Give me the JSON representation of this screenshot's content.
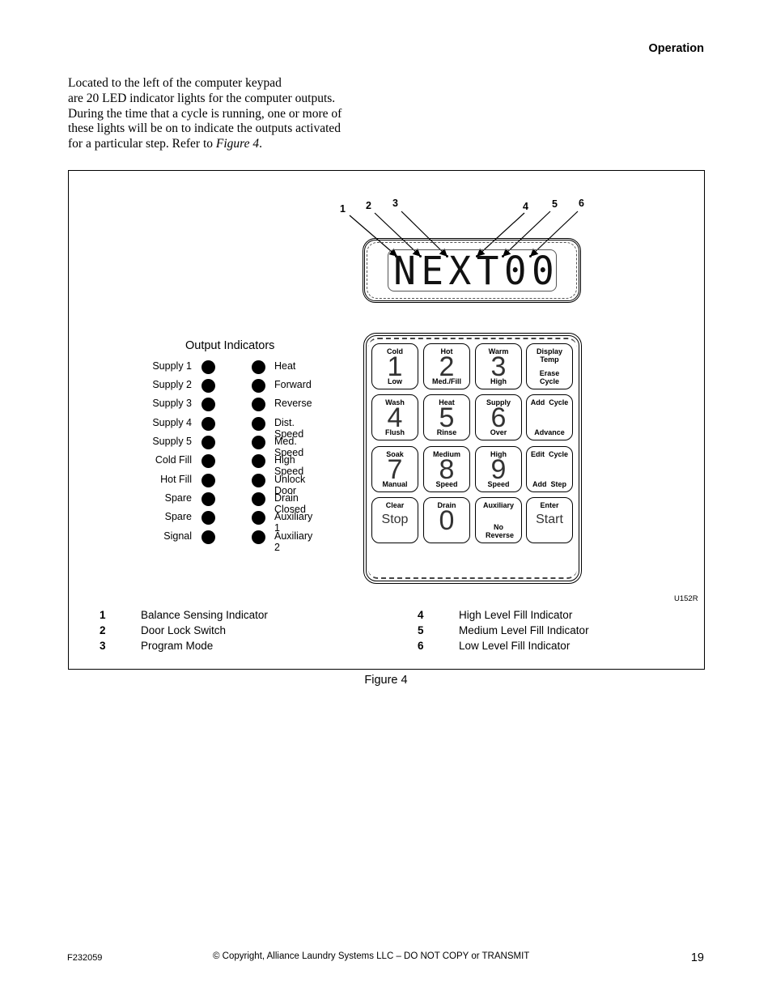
{
  "header": {
    "section": "Operation"
  },
  "intro": {
    "lines": [
      "Located to the left of the computer keypad",
      "are 20 LED indicator lights for the computer outputs.",
      "During the time that a cycle is running, one or more of",
      "these lights will be on to indicate the outputs activated"
    ],
    "last_line_prefix": "for a particular step. Refer to ",
    "last_line_ref": "Figure 4",
    "last_line_suffix": "."
  },
  "figure": {
    "display": {
      "text": [
        "N",
        "E",
        "X",
        "T",
        "0",
        "0"
      ],
      "callouts": [
        "1",
        "2",
        "3",
        "4",
        "5",
        "6"
      ]
    },
    "output_indicators": {
      "title": "Output Indicators",
      "left": [
        "Supply 1",
        "Supply 2",
        "Supply 3",
        "Supply 4",
        "Supply 5",
        "Cold Fill",
        "Hot Fill",
        "Spare",
        "Spare",
        "Signal"
      ],
      "right": [
        "Heat",
        "Forward",
        "Reverse",
        "Dist. Speed",
        "Med. Speed",
        "High Speed",
        "Unlock Door",
        "Drain Closed",
        "Auxiliary 1",
        "Auxiliary 2"
      ]
    },
    "keypad": {
      "keys": [
        {
          "top": "Cold",
          "main": "1",
          "bottom": "Low"
        },
        {
          "top": "Hot",
          "main": "2",
          "bottom": "Med./Fill"
        },
        {
          "top": "Warm",
          "main": "3",
          "bottom": "High"
        },
        {
          "top": "Display Temp",
          "main": "",
          "bottom": "Erase Cycle"
        },
        {
          "top": "Wash",
          "main": "4",
          "bottom": "Flush"
        },
        {
          "top": "Heat",
          "main": "5",
          "bottom": "Rinse"
        },
        {
          "top": "Supply",
          "main": "6",
          "bottom": "Over"
        },
        {
          "top": "Add  Cycle",
          "main": "",
          "bottom": "Advance"
        },
        {
          "top": "Soak",
          "main": "7",
          "bottom": "Manual"
        },
        {
          "top": "Medium",
          "main": "8",
          "bottom": "Speed"
        },
        {
          "top": "High",
          "main": "9",
          "bottom": "Speed"
        },
        {
          "top": "Edit  Cycle",
          "main": "",
          "bottom": "Add  Step"
        },
        {
          "top": "Clear",
          "main": "Stop",
          "bottom": ""
        },
        {
          "top": "Drain",
          "main": "0",
          "bottom": ""
        },
        {
          "top": "Auxiliary",
          "main": "",
          "bottom": "No Reverse"
        },
        {
          "top": "Enter",
          "main": "Start",
          "bottom": ""
        }
      ]
    },
    "code": "U152R",
    "legend": [
      {
        "num": "1",
        "text": "Balance Sensing Indicator"
      },
      {
        "num": "2",
        "text": "Door Lock Switch"
      },
      {
        "num": "3",
        "text": "Program Mode"
      },
      {
        "num": "4",
        "text": "High Level Fill Indicator"
      },
      {
        "num": "5",
        "text": "Medium Level Fill Indicator"
      },
      {
        "num": "6",
        "text": "Low Level Fill Indicator"
      }
    ],
    "caption": "Figure 4"
  },
  "footer": {
    "doc_code": "F232059",
    "copyright": "© Copyright, Alliance Laundry Systems LLC – DO NOT COPY or TRANSMIT",
    "page_number": "19"
  }
}
